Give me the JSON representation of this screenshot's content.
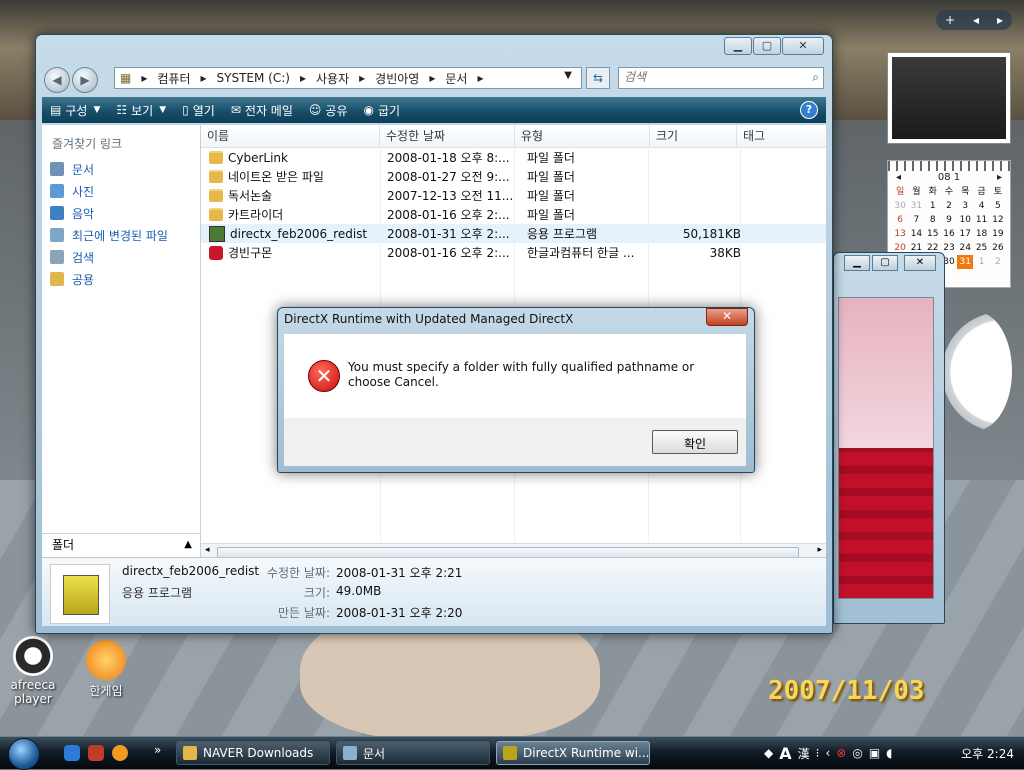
{
  "explorer": {
    "address": {
      "parts": [
        "컴퓨터",
        "SYSTEM (C:)",
        "사용자",
        "경빈아영",
        "문서"
      ]
    },
    "search_placeholder": "검색",
    "toolbar": {
      "organize": "구성",
      "views": "보기",
      "open": "열기",
      "email": "전자 메일",
      "share": "공유",
      "burn": "굽기"
    },
    "sidebar": {
      "title": "즐겨찾기 링크",
      "items": [
        "문서",
        "사진",
        "음악",
        "최근에 변경된 파일",
        "검색",
        "공용"
      ],
      "folders_label": "폴더"
    },
    "columns": {
      "name": "이름",
      "date": "수정한 날짜",
      "type": "유형",
      "size": "크기",
      "tags": "태그"
    },
    "files": [
      {
        "name": "CyberLink",
        "date": "2008-01-18 오후 8:...",
        "type": "파일 폴더",
        "size": "",
        "kind": "folder"
      },
      {
        "name": "네이트온 받은 파일",
        "date": "2008-01-27 오전 9:...",
        "type": "파일 폴더",
        "size": "",
        "kind": "folder"
      },
      {
        "name": "독서논술",
        "date": "2007-12-13 오전 11...",
        "type": "파일 폴더",
        "size": "",
        "kind": "folder"
      },
      {
        "name": "카트라이더",
        "date": "2008-01-16 오후 2:...",
        "type": "파일 폴더",
        "size": "",
        "kind": "folder"
      },
      {
        "name": "directx_feb2006_redist",
        "date": "2008-01-31 오후 2:...",
        "type": "응용 프로그램",
        "size": "50,181KB",
        "kind": "exe"
      },
      {
        "name": "경빈구몬",
        "date": "2008-01-16 오후 2:...",
        "type": "한글과컴퓨터 한글 ...",
        "size": "38KB",
        "kind": "hwp"
      }
    ],
    "details": {
      "name": "directx_feb2006_redist",
      "type": "응용 프로그램",
      "modified_label": "수정한 날짜:",
      "modified": "2008-01-31 오후 2:21",
      "size_label": "크기:",
      "size": "49.0MB",
      "created_label": "만든 날짜:",
      "created": "2008-01-31 오후 2:20"
    }
  },
  "dialog": {
    "title": "DirectX Runtime with Updated Managed DirectX",
    "message": "You must specify a folder with fully qualified pathname or choose Cancel.",
    "ok": "확인"
  },
  "desktop": {
    "icons": [
      {
        "label": "afreeca player"
      },
      {
        "label": "한게임"
      }
    ],
    "photo_date": "2007/11/03"
  },
  "calendar": {
    "month": "08 1",
    "weekdays": [
      "일",
      "월",
      "화",
      "수",
      "목",
      "금",
      "토"
    ],
    "rows": [
      [
        "30",
        "31",
        "1",
        "2",
        "3",
        "4",
        "5"
      ],
      [
        "6",
        "7",
        "8",
        "9",
        "10",
        "11",
        "12"
      ],
      [
        "13",
        "14",
        "15",
        "16",
        "17",
        "18",
        "19"
      ],
      [
        "20",
        "21",
        "22",
        "23",
        "24",
        "25",
        "26"
      ],
      [
        "27",
        "28",
        "29",
        "30",
        "31",
        "1",
        "2"
      ]
    ],
    "today": "31"
  },
  "taskbar": {
    "buttons": [
      "NAVER Downloads",
      "문서",
      "DirectX Runtime wi..."
    ],
    "ime": "A",
    "hanja": "漢",
    "time": "오후 2:24"
  }
}
